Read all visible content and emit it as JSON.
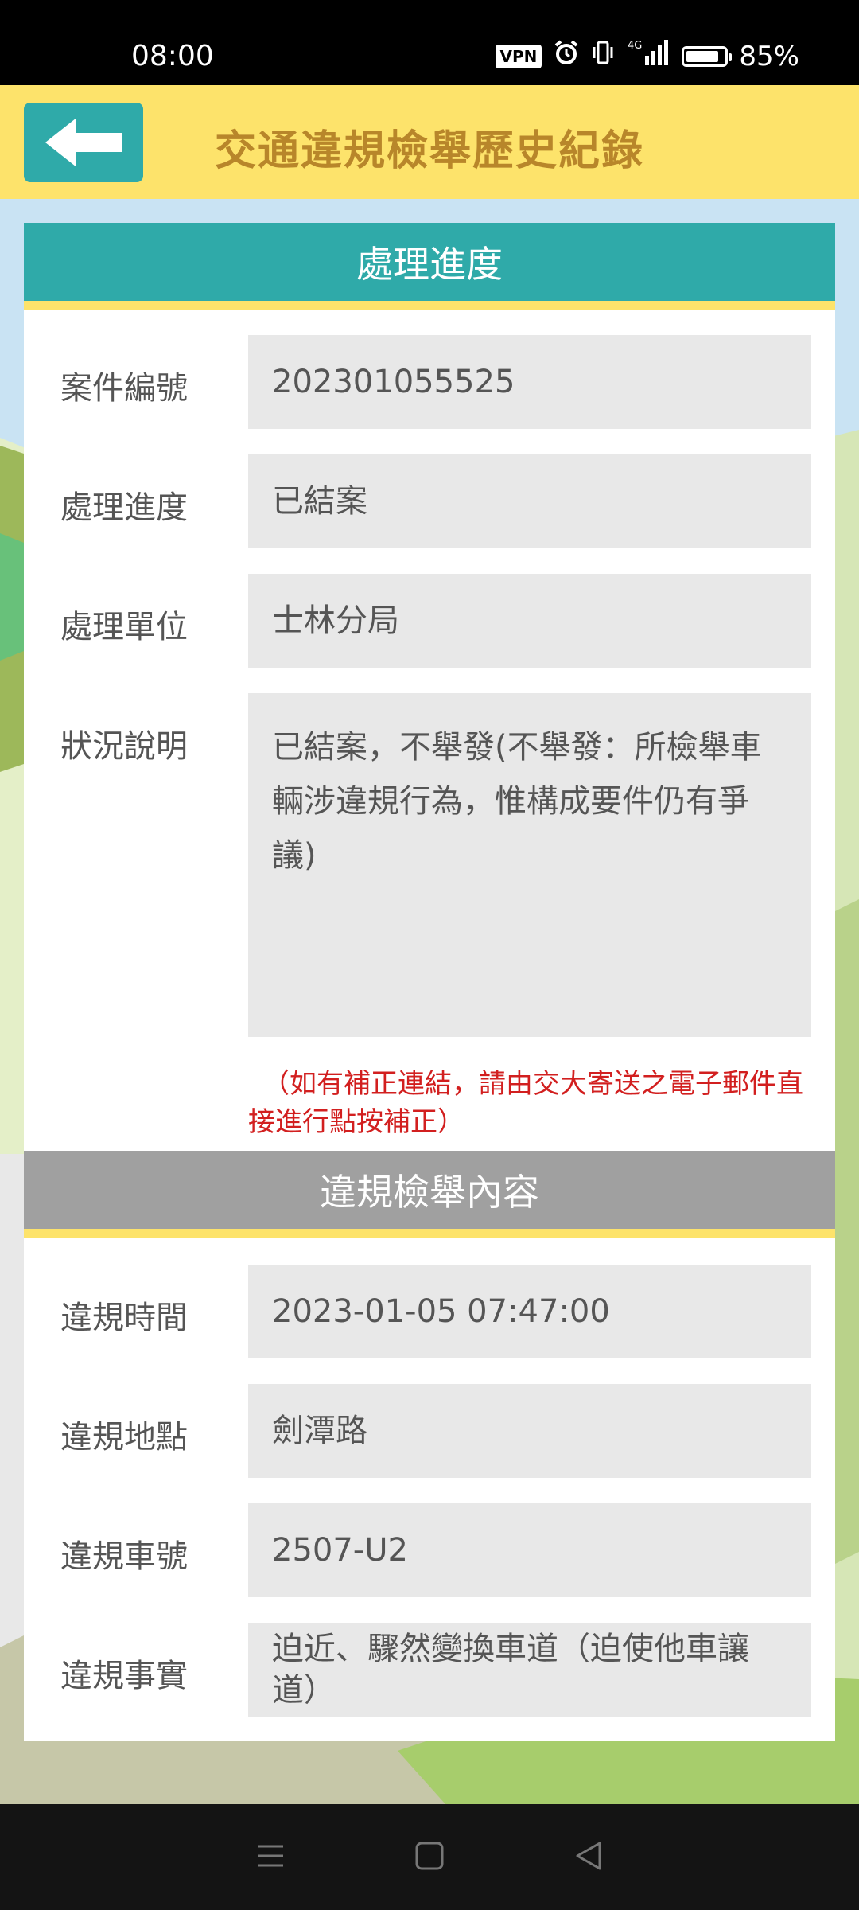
{
  "status_bar": {
    "time": "08:00",
    "vpn": "VPN",
    "network": "4G",
    "battery_level": 0.85,
    "battery_text": "85%"
  },
  "header": {
    "title": "交通違規檢舉歷史紀錄",
    "back_icon": "arrow-left-icon"
  },
  "progress_section": {
    "title": "處理進度",
    "fields": [
      {
        "label": "案件編號",
        "value": "202301055525"
      },
      {
        "label": "處理進度",
        "value": "已結案"
      },
      {
        "label": "處理單位",
        "value": "士林分局"
      },
      {
        "label": "狀況說明",
        "value": "已結案，不舉發(不舉發：所檢舉車輛涉違規行為，惟構成要件仍有爭議)"
      }
    ],
    "note": "（如有補正連結，請由交大寄送之電子郵件直接進行點按補正）"
  },
  "content_section": {
    "title": "違規檢舉內容",
    "fields": [
      {
        "label": "違規時間",
        "value": "2023-01-05 07:47:00"
      },
      {
        "label": "違規地點",
        "value": "劍潭路"
      },
      {
        "label": "違規車號",
        "value": "2507-U2"
      },
      {
        "label": "違規事實",
        "value": "迫近、驟然變換車道（迫使他車讓道）"
      }
    ]
  },
  "colors": {
    "header_bg": "#fde36b",
    "title_color": "#b8862a",
    "teal": "#2faaa9",
    "section_gray": "#a0a0a0",
    "note_red": "#d21f1f",
    "field_bg": "#e8e8e8"
  },
  "nav_bar": {
    "icons": [
      "menu-icon",
      "home-icon",
      "back-triangle-icon"
    ]
  }
}
